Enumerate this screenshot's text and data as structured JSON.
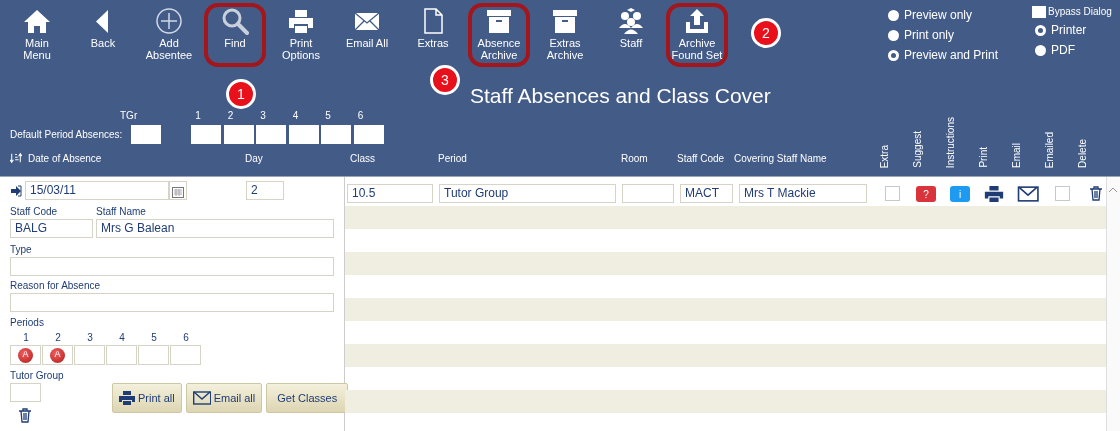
{
  "toolbar": [
    {
      "label": "Main Menu",
      "highlighted": false
    },
    {
      "label": "Back",
      "highlighted": false
    },
    {
      "label": "Add Absentee",
      "highlighted": false
    },
    {
      "label": "Find",
      "highlighted": true
    },
    {
      "label": "Print Options",
      "highlighted": false
    },
    {
      "label": "Email All",
      "highlighted": false
    },
    {
      "label": "Extras",
      "highlighted": false
    },
    {
      "label": "Absence Archive",
      "highlighted": true
    },
    {
      "label": "Extras Archive",
      "highlighted": false
    },
    {
      "label": "Staff",
      "highlighted": false
    },
    {
      "label": "Archive Found Set",
      "highlighted": true
    }
  ],
  "annotations": [
    "1",
    "2",
    "3"
  ],
  "title": "Staff Absences and Class Cover",
  "print_mode": [
    {
      "label": "Preview only",
      "selected": false
    },
    {
      "label": "Print only",
      "selected": false
    },
    {
      "label": "Preview and Print",
      "selected": true
    }
  ],
  "bypass_dialog": {
    "label": "Bypass Dialog",
    "checked": false
  },
  "output": [
    {
      "label": "Printer",
      "selected": true
    },
    {
      "label": "PDF",
      "selected": false
    }
  ],
  "default_periods": {
    "label": "Default Period Absences:",
    "tgr_label": "TGr",
    "periods": [
      "1",
      "2",
      "3",
      "4",
      "5",
      "6"
    ]
  },
  "columns": [
    "Date of Absence",
    "Day",
    "Class",
    "Period",
    "Room",
    "Staff Code",
    "Covering Staff Name"
  ],
  "vertical_columns": [
    "Extra",
    "Suggest",
    "Instructions",
    "Print",
    "Email",
    "Emailed",
    "Delete"
  ],
  "record": {
    "date": "15/03/11",
    "day": "2",
    "staff_code_label": "Staff Code",
    "staff_code": "BALG",
    "staff_name_label": "Staff Name",
    "staff_name": "Mrs G Balean",
    "type_label": "Type",
    "reason_label": "Reason for Absence",
    "periods_label": "Periods",
    "periods": [
      {
        "label": "1",
        "absent": true,
        "mark": "A"
      },
      {
        "label": "2",
        "absent": true,
        "mark": "A"
      },
      {
        "label": "3",
        "absent": false
      },
      {
        "label": "4",
        "absent": false
      },
      {
        "label": "5",
        "absent": false
      },
      {
        "label": "6",
        "absent": false
      }
    ],
    "tutor_group_label": "Tutor Group",
    "buttons": [
      "Print all",
      "Email all",
      "Get Classes"
    ]
  },
  "cover_rows": [
    {
      "class": "10.5",
      "period": "Tutor Group",
      "room": "",
      "staff_code": "MACT",
      "covering_staff": "Mrs T Mackie",
      "extra": false,
      "suggest": "?",
      "instructions": "i",
      "emailed": false
    }
  ]
}
